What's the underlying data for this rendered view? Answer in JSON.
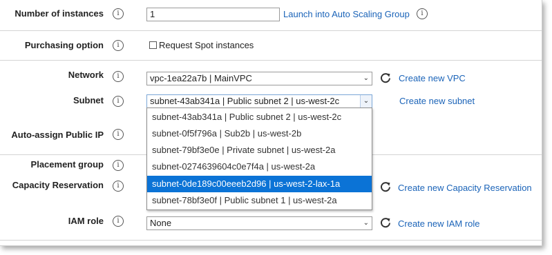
{
  "instances": {
    "label": "Number of instances",
    "value": "1",
    "link": "Launch into Auto Scaling Group"
  },
  "purchasing": {
    "label": "Purchasing option",
    "checkbox_label": "Request Spot instances",
    "checked": false
  },
  "network": {
    "label": "Network",
    "value": "vpc-1ea22a7b | MainVPC",
    "link": "Create new VPC"
  },
  "subnet": {
    "label": "Subnet",
    "value": "subnet-43ab341a | Public subnet 2 | us-west-2c",
    "link": "Create new subnet",
    "options": [
      "subnet-43ab341a | Public subnet 2 | us-west-2c",
      "subnet-0f5f796a | Sub2b | us-west-2b",
      "subnet-79bf3e0e | Private subnet | us-west-2a",
      "subnet-0274639604c0e7f4a | us-west-2a",
      "subnet-0de189c00eeeb2d96 | us-west-2-lax-1a",
      "subnet-78bf3e0f | Public subnet 1 | us-west-2a"
    ],
    "highlighted_option": "subnet-0de189c00eeeb2d96 | us-west-2-lax-1a"
  },
  "auto_assign": {
    "label": "Auto-assign Public IP"
  },
  "placement": {
    "label": "Placement group"
  },
  "capacity": {
    "label": "Capacity Reservation",
    "link": "Create new Capacity Reservation"
  },
  "iam": {
    "label": "IAM role",
    "value": "None",
    "link": "Create new IAM role"
  },
  "info_glyph": "i",
  "colors": {
    "link": "#1a63b8",
    "highlight": "#0b73d6",
    "divider": "#d4d4d4"
  },
  "icons": {
    "info": "info-circle-icon",
    "refresh": "refresh-icon",
    "dropdown": "chevron-down-icon"
  }
}
